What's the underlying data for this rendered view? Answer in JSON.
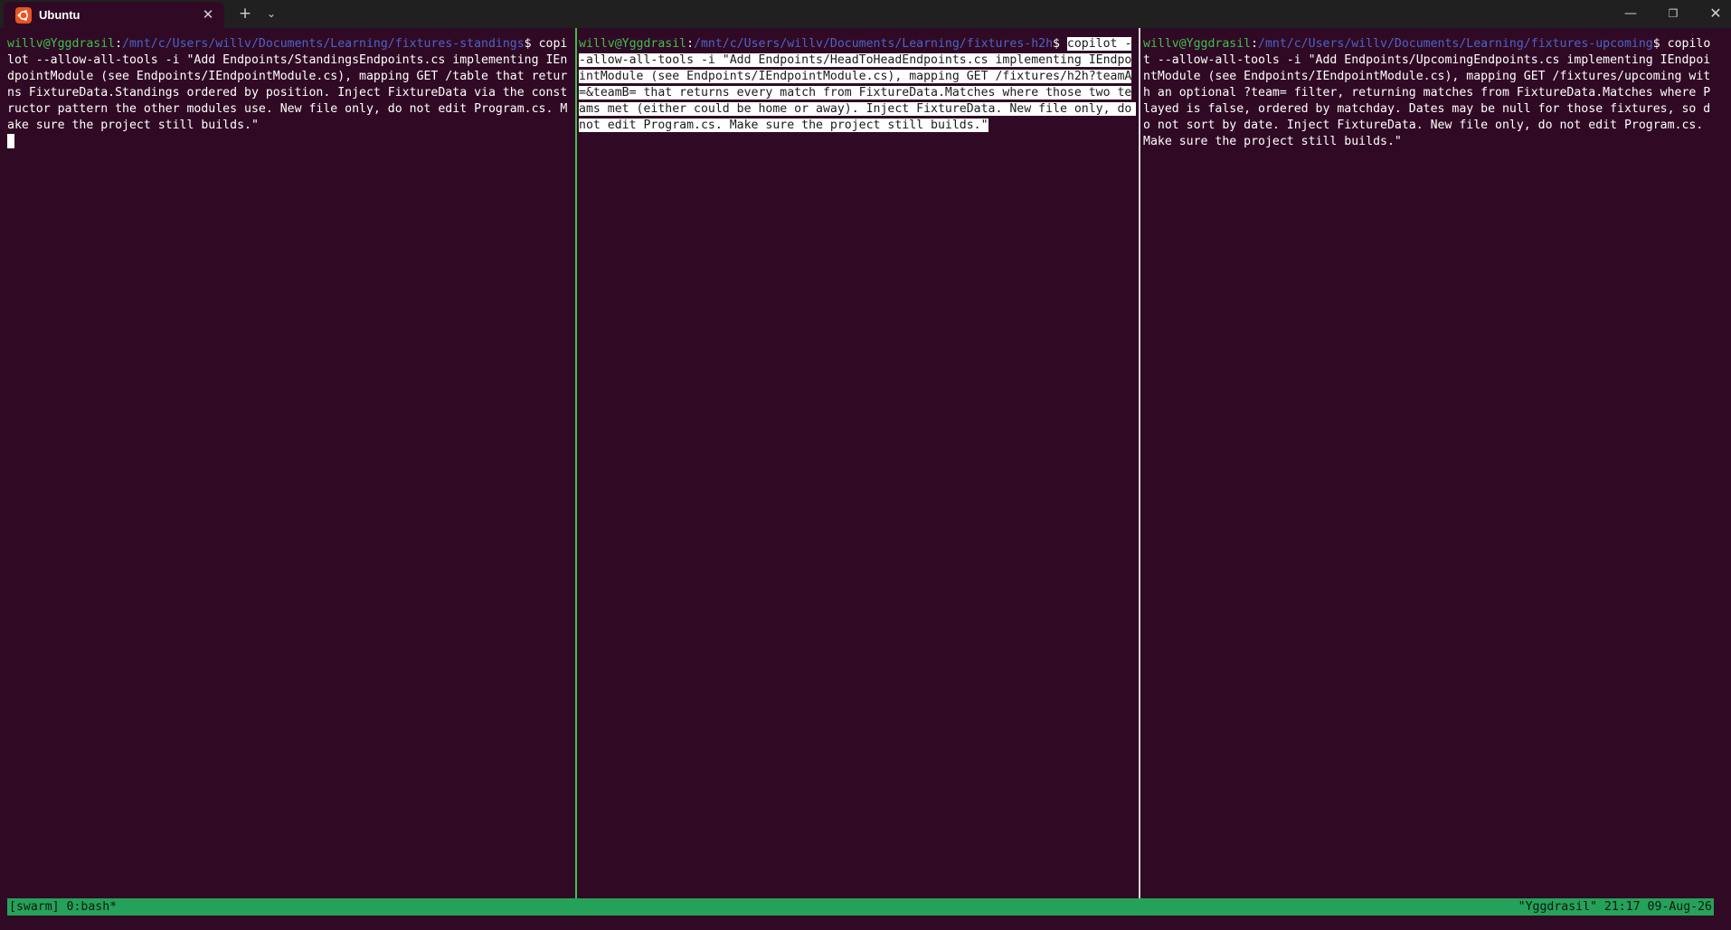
{
  "window": {
    "tab_title": "Ubuntu",
    "tab_icon": "ubuntu-icon",
    "new_tab_label": "+",
    "dropdown_label": "⌄",
    "minimize_label": "—",
    "maximize_label": "❐",
    "close_label": "✕",
    "tab_close_label": "✕"
  },
  "colors": {
    "terminal_bg": "#300a24",
    "prompt_user": "#3fbf4f",
    "prompt_path": "#4d63c9",
    "status_bar": "#26a15a",
    "active_divider": "#3fbf4f"
  },
  "panes": [
    {
      "prompt_user": "willv@Yggdrasil",
      "prompt_sep": ":",
      "prompt_path": "/mnt/c/Users/willv/Documents/Learning/fixtures-standings",
      "prompt_end": "$ ",
      "command": "copilot --allow-all-tools -i \"Add Endpoints/StandingsEndpoints.cs implementing IEndpointModule (see Endpoints/IEndpointModule.cs), mapping GET /table that returns FixtureData.Standings ordered by position. Inject FixtureData via the constructor pattern the other modules use. New file only, do not edit Program.cs. Make sure the project still builds.\""
    },
    {
      "prompt_user": "willv@Yggdrasil",
      "prompt_sep": ":",
      "prompt_path": "/mnt/c/Users/willv/Documents/Learning/fixtures-h2h",
      "prompt_end": "$ ",
      "command": "copilot --allow-all-tools -i \"Add Endpoints/HeadToHeadEndpoints.cs implementing IEndpointModule (see Endpoints/IEndpointModule.cs), mapping GET /fixtures/h2h?teamA=&teamB= that returns every match from FixtureData.Matches where those two teams met (either could be home or away). Inject FixtureData. New file only, do not edit Program.cs. Make sure the project still builds.\""
    },
    {
      "prompt_user": "willv@Yggdrasil",
      "prompt_sep": ":",
      "prompt_path": "/mnt/c/Users/willv/Documents/Learning/fixtures-upcoming",
      "prompt_end": "$ ",
      "command": "copilot --allow-all-tools -i \"Add Endpoints/UpcomingEndpoints.cs implementing IEndpointModule (see Endpoints/IEndpointModule.cs), mapping GET /fixtures/upcoming with an optional ?team= filter, returning matches from FixtureData.Matches where Played is false, ordered by matchday. Dates may be null for those fixtures, so do not sort by date. Inject FixtureData. New file only, do not edit Program.cs. Make sure the project still builds.\""
    }
  ],
  "status": {
    "left": "[swarm] 0:bash*",
    "right": "\"Yggdrasil\" 21:17 09-Aug-26"
  }
}
